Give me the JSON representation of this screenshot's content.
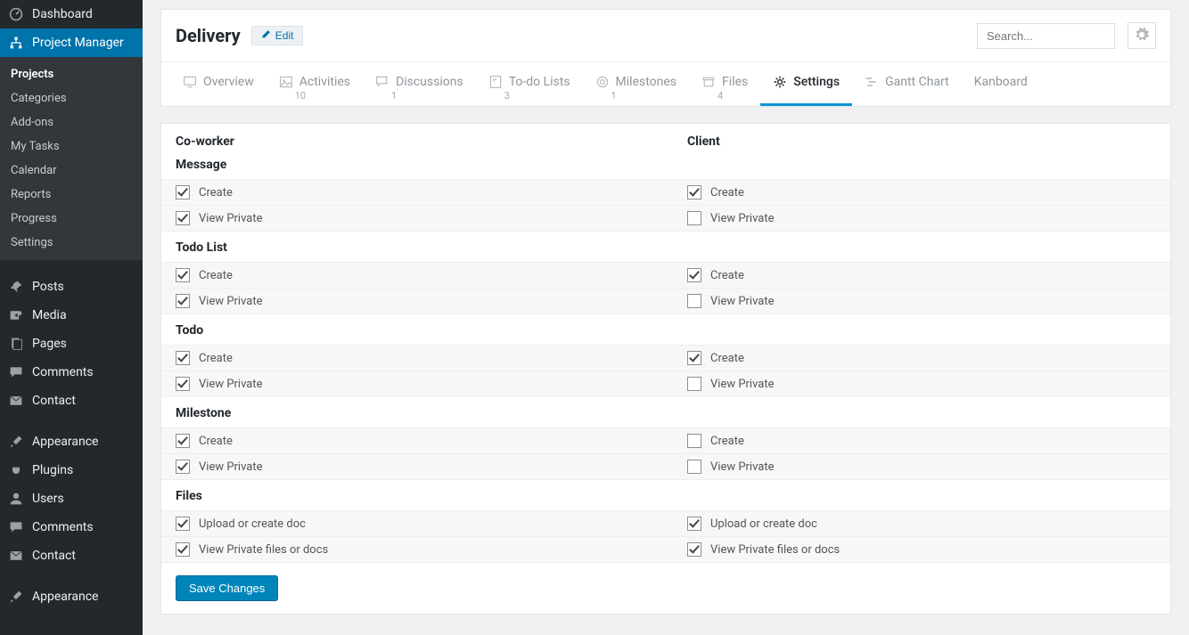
{
  "sidebar": {
    "dashboard": "Dashboard",
    "project_manager": "Project Manager",
    "submenu": [
      "Projects",
      "Categories",
      "Add-ons",
      "My Tasks",
      "Calendar",
      "Reports",
      "Progress",
      "Settings"
    ],
    "posts": "Posts",
    "media": "Media",
    "pages": "Pages",
    "comments": "Comments",
    "contact": "Contact",
    "appearance": "Appearance",
    "plugins": "Plugins",
    "users": "Users",
    "comments2": "Comments",
    "contact2": "Contact",
    "appearance2": "Appearance"
  },
  "header": {
    "title": "Delivery",
    "edit": "Edit",
    "search_placeholder": "Search..."
  },
  "tabs": {
    "overview": "Overview",
    "activities": "Activities",
    "activities_count": "10",
    "discussions": "Discussions",
    "discussions_count": "1",
    "todo_lists": "To-do Lists",
    "todo_lists_count": "3",
    "milestones": "Milestones",
    "milestones_count": "1",
    "files": "Files",
    "files_count": "4",
    "settings": "Settings",
    "gantt": "Gantt Chart",
    "kanboard": "Kanboard"
  },
  "columns": {
    "coworker": "Co-worker",
    "client": "Client"
  },
  "sections": [
    {
      "title": "Message",
      "rows": [
        {
          "label": "Create",
          "coworker": true,
          "client": true
        },
        {
          "label": "View Private",
          "coworker": true,
          "client": false
        }
      ]
    },
    {
      "title": "Todo List",
      "rows": [
        {
          "label": "Create",
          "coworker": true,
          "client": true
        },
        {
          "label": "View Private",
          "coworker": true,
          "client": false
        }
      ]
    },
    {
      "title": "Todo",
      "rows": [
        {
          "label": "Create",
          "coworker": true,
          "client": true
        },
        {
          "label": "View Private",
          "coworker": true,
          "client": false
        }
      ]
    },
    {
      "title": "Milestone",
      "rows": [
        {
          "label": "Create",
          "coworker": true,
          "client": false
        },
        {
          "label": "View Private",
          "coworker": true,
          "client": false
        }
      ]
    },
    {
      "title": "Files",
      "rows": [
        {
          "label": "Upload or create doc",
          "coworker": true,
          "client": true
        },
        {
          "label": "View Private files or docs",
          "coworker": true,
          "client": true
        }
      ]
    }
  ],
  "save_label": "Save Changes"
}
